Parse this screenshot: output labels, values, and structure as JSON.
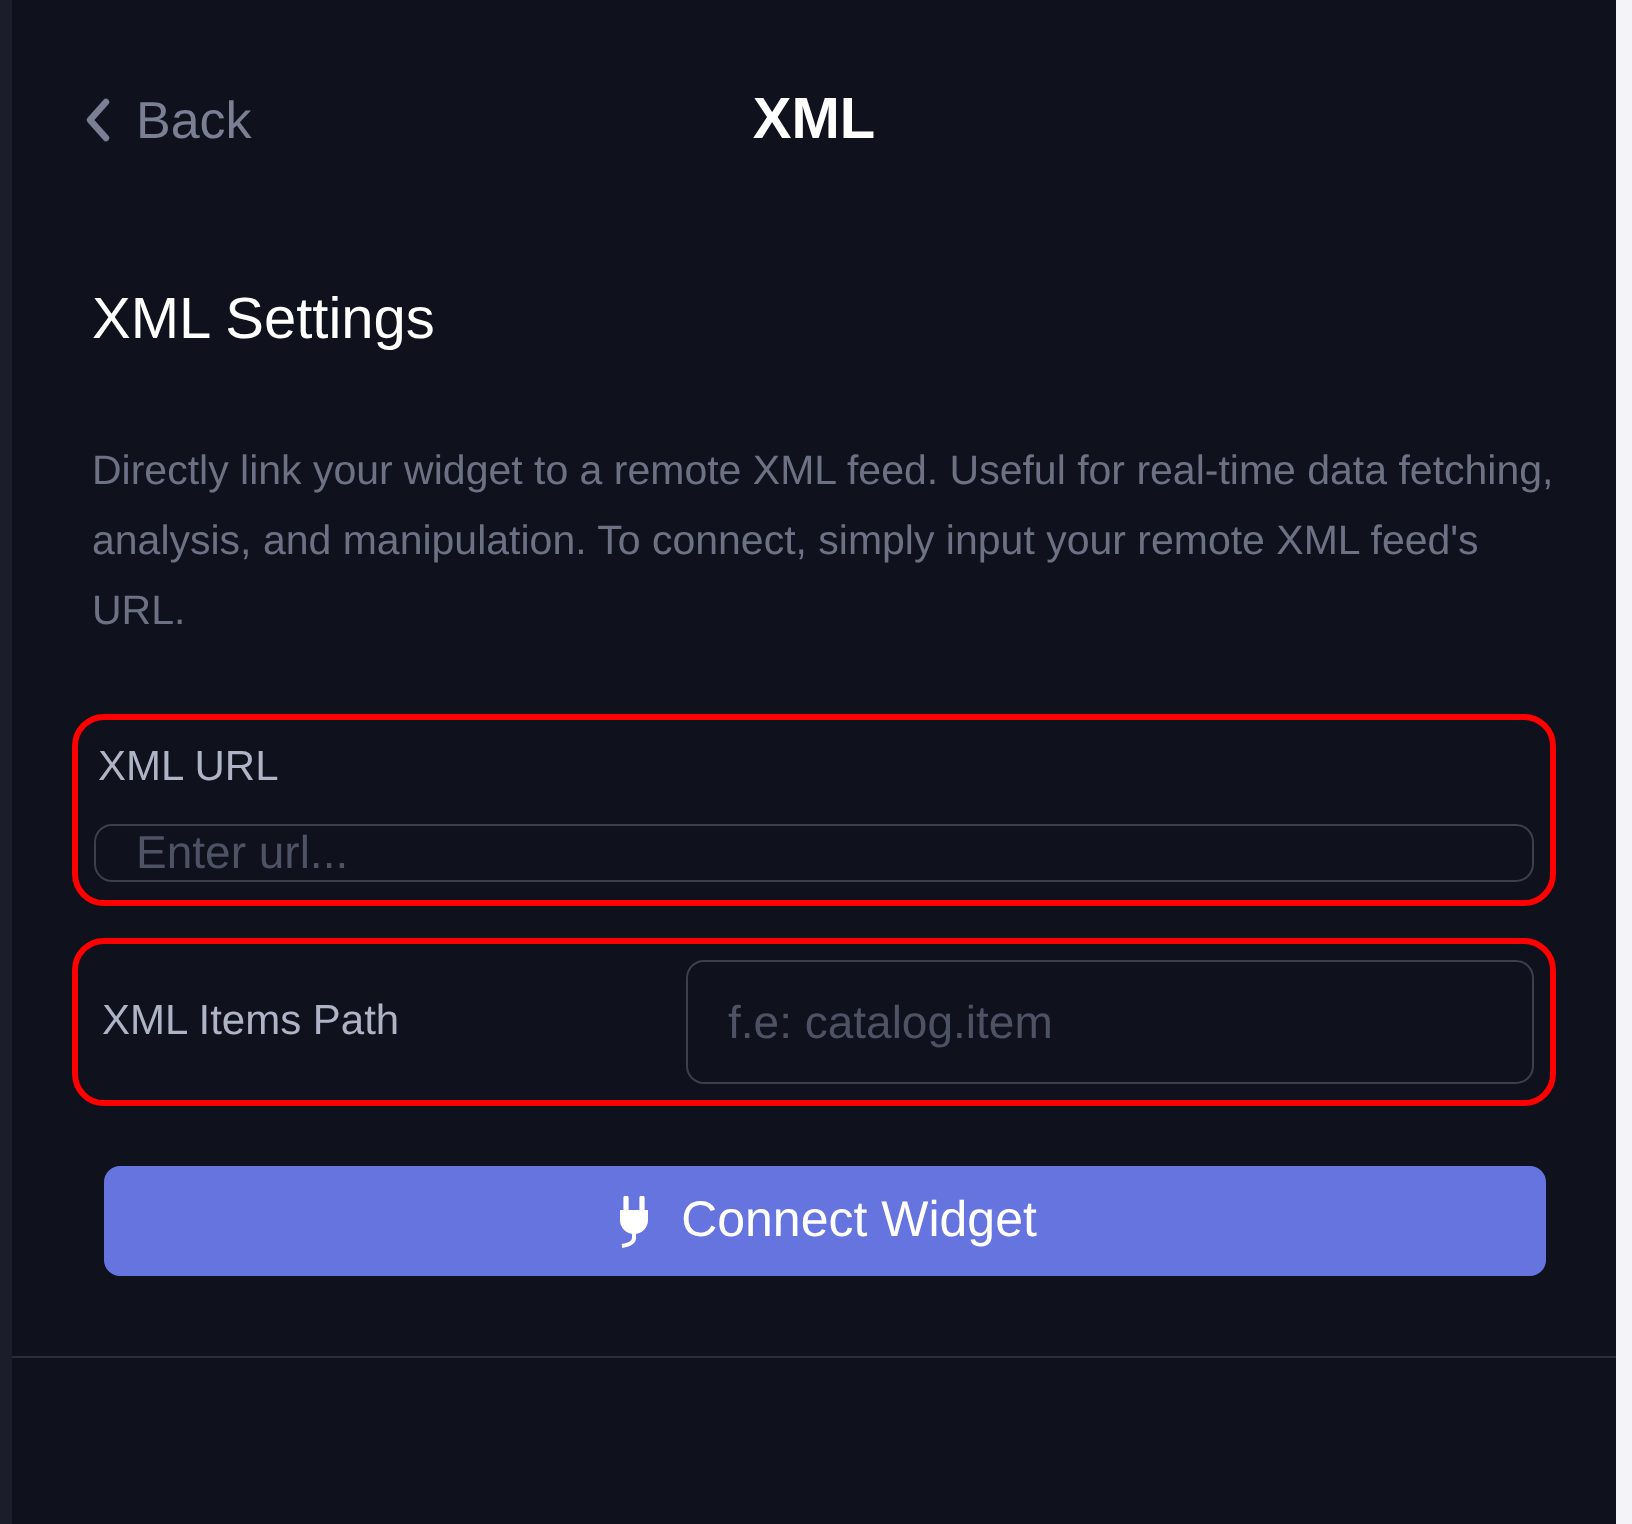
{
  "header": {
    "back_label": "Back",
    "title": "XML"
  },
  "section": {
    "heading": "XML Settings",
    "description": "Directly link your widget to a remote XML feed. Useful for real-time data fetching, analysis, and manipulation. To connect, simply input your remote XML feed's URL."
  },
  "fields": [
    {
      "kind": "stacked",
      "label": "XML URL",
      "placeholder": "Enter url...",
      "highlighted": true
    },
    {
      "kind": "inline",
      "label": "XML Items Path",
      "placeholder": "f.e: catalog.item",
      "highlighted": true
    }
  ],
  "button": {
    "label": "Connect Widget"
  }
}
